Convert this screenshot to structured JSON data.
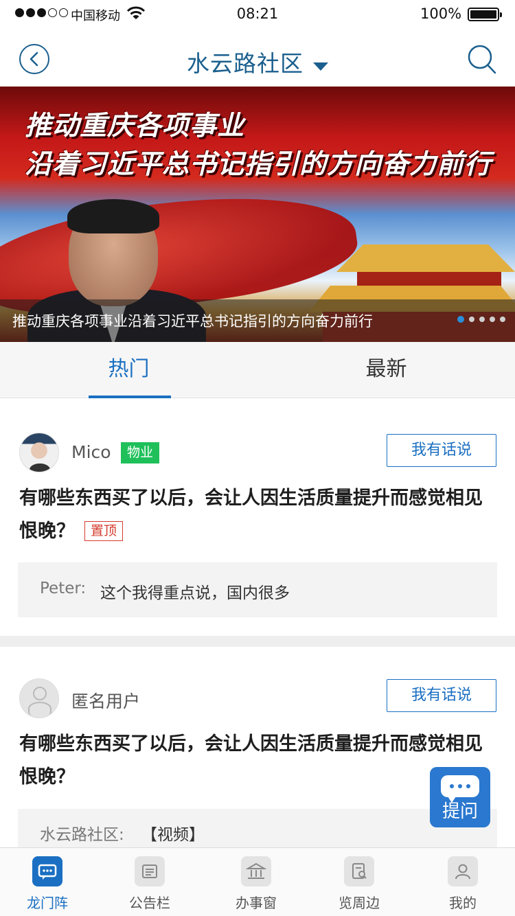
{
  "status_bar": {
    "carrier": "中国移动",
    "time": "08:21",
    "battery": "100%"
  },
  "nav": {
    "title": "水云路社区",
    "back_icon": "back-circle-icon",
    "search_icon": "search-icon",
    "accent_color": "#1a5f8e"
  },
  "banner": {
    "headline_line1": "推动重庆各项事业",
    "headline_line2": "沿着习近平总书记指引的方向奋力前行",
    "caption": "推动重庆各项事业沿着习近平总书记指引的方向奋力前行",
    "slide_count": 5,
    "active_slide": 1
  },
  "tabs": {
    "items": [
      {
        "label": "热门",
        "active": true
      },
      {
        "label": "最新",
        "active": false
      }
    ],
    "active_color": "#1a6fc2"
  },
  "posts": [
    {
      "user": "Mico",
      "badge": "物业",
      "action": "我有话说",
      "title": "有哪些东西买了以后，会让人因生活质量提升而感觉相见恨晚？",
      "pin_badge": "置顶",
      "reply_name": "Peter:",
      "reply_text": "这个我得重点说，国内很多"
    },
    {
      "user": "匿名用户",
      "action": "我有话说",
      "title": "有哪些东西买了以后，会让人因生活质量提升而感觉相见恨晚？",
      "reply_name": "水云路社区:",
      "reply_text": "【视频】"
    }
  ],
  "ask_button": {
    "label": "提问",
    "icon": "chat-bubble-icon"
  },
  "tabbar": {
    "items": [
      {
        "label": "龙门阵",
        "icon": "chat-icon",
        "active": true
      },
      {
        "label": "公告栏",
        "icon": "notice-board-icon",
        "active": false
      },
      {
        "label": "办事窗",
        "icon": "government-building-icon",
        "active": false
      },
      {
        "label": "览周边",
        "icon": "nearby-search-icon",
        "active": false
      },
      {
        "label": "我的",
        "icon": "user-icon",
        "active": false
      }
    ]
  }
}
